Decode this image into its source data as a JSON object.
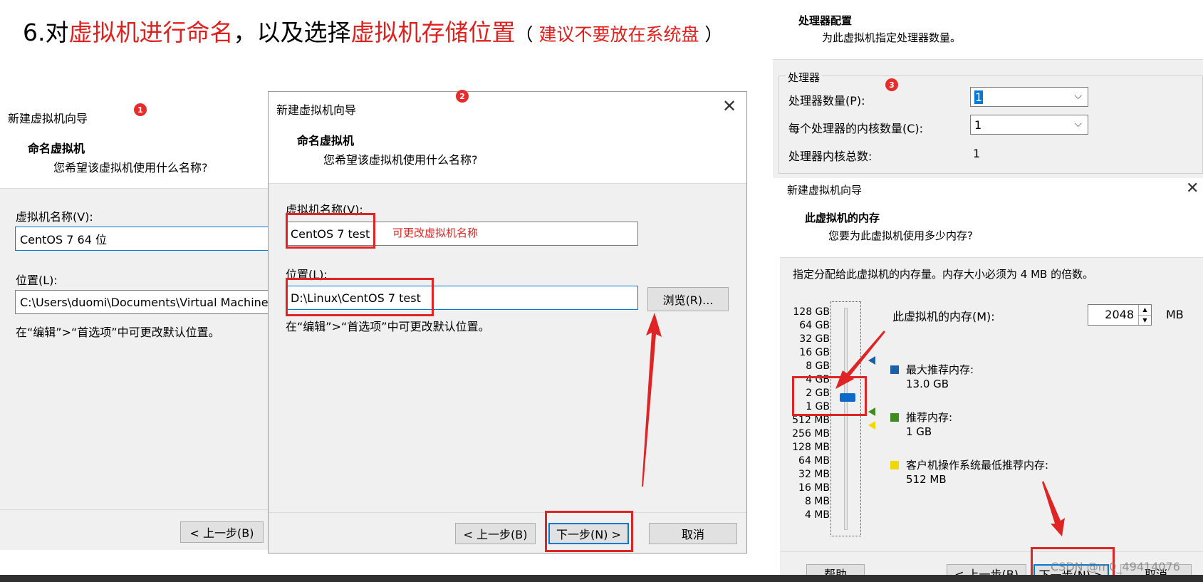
{
  "title": {
    "step": "6.对",
    "part1": "虚拟机进行命名",
    "sep": "，以及选择",
    "part2": "虚拟机存储位置",
    "paren_open": "（",
    "note": " 建议不要放在系统盘 ",
    "paren_close": "）"
  },
  "dialog1": {
    "badge": "1",
    "window_title": "新建虚拟机向导",
    "header_title": "命名虚拟机",
    "header_subtitle": "您希望该虚拟机使用什么名称?",
    "name_label": "虚拟机名称(V):",
    "name_value": "CentOS 7 64 位",
    "location_label": "位置(L):",
    "location_value": "C:\\Users\\duomi\\Documents\\Virtual Machines\\C",
    "hint": "在“编辑”>“首选项”中可更改默认位置。",
    "back_button": "< 上一步(B)"
  },
  "dialog2": {
    "badge": "2",
    "window_title": "新建虚拟机向导",
    "header_title": "命名虚拟机",
    "header_subtitle": "您希望该虚拟机使用什么名称?",
    "name_label": "虚拟机名称(V):",
    "name_value": "CentOS 7 test",
    "name_annotation": "可更改虚拟机名称",
    "location_label": "位置(L):",
    "location_value": "D:\\Linux\\CentOS 7 test",
    "browse_button": "浏览(R)...",
    "hint": "在“编辑”>“首选项”中可更改默认位置。",
    "back_button": "< 上一步(B)",
    "next_button": "下一步(N) >",
    "cancel_button": "取消"
  },
  "processor": {
    "badge": "3",
    "header_title": "处理器配置",
    "header_subtitle": "为此虚拟机指定处理器数量。",
    "group_label": "处理器",
    "count_label": "处理器数量(P):",
    "count_value": "1",
    "cores_label": "每个处理器的内核数量(C):",
    "cores_value": "1",
    "total_label": "处理器内核总数:",
    "total_value": "1"
  },
  "memory": {
    "window_title": "新建虚拟机向导",
    "header_title": "此虚拟机的内存",
    "header_subtitle": "您要为此虚拟机使用多少内存?",
    "description": "指定分配给此虚拟机的内存量。内存大小必须为 4 MB 的倍数。",
    "scale": [
      "128 GB",
      "64 GB",
      "32 GB",
      "16 GB",
      "8 GB",
      "4 GB",
      "2 GB",
      "1 GB",
      "512 MB",
      "256 MB",
      "128 MB",
      "64 MB",
      "32 MB",
      "16 MB",
      "8 MB",
      "4 MB"
    ],
    "memory_label": "此虚拟机的内存(M):",
    "memory_value": "2048",
    "memory_unit": "MB",
    "max_label": "最大推荐内存:",
    "max_value": "13.0 GB",
    "rec_label": "推荐内存:",
    "rec_value": "1 GB",
    "min_label": "客户机操作系统最低推荐内存:",
    "min_value": "512 MB",
    "help_button": "帮助",
    "back_button": "< 上一步(B)",
    "next_button": "下一步(N) >",
    "cancel_button": "取消",
    "watermark": "CSDN @m0_49414076",
    "colors": {
      "max": "#1a5fa8",
      "rec": "#3d8c1e",
      "min": "#f0d800"
    }
  }
}
